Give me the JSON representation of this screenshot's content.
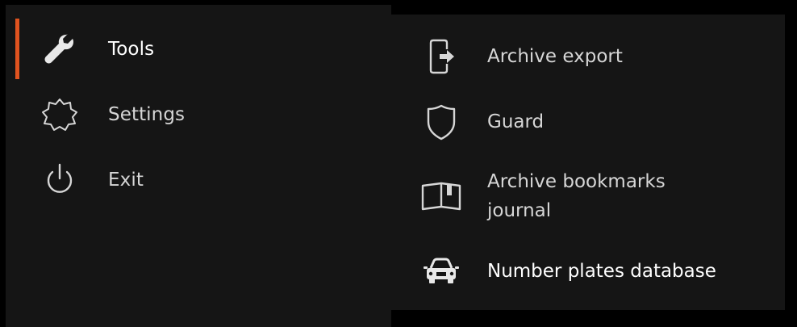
{
  "main_menu": {
    "items": [
      {
        "label": "Tools",
        "icon": "wrench-icon",
        "active": true
      },
      {
        "label": "Settings",
        "icon": "gear-icon",
        "active": false
      },
      {
        "label": "Exit",
        "icon": "power-icon",
        "active": false
      }
    ]
  },
  "submenu": {
    "items": [
      {
        "label": "Archive export",
        "icon": "export-icon"
      },
      {
        "label": "Guard",
        "icon": "shield-icon"
      },
      {
        "label": "Archive bookmarks journal",
        "icon": "book-icon"
      },
      {
        "label": "Number plates database",
        "icon": "car-icon"
      }
    ]
  },
  "colors": {
    "background": "#000000",
    "panel": "#151515",
    "accent": "#e0531f",
    "text": "#d6d6d6"
  }
}
